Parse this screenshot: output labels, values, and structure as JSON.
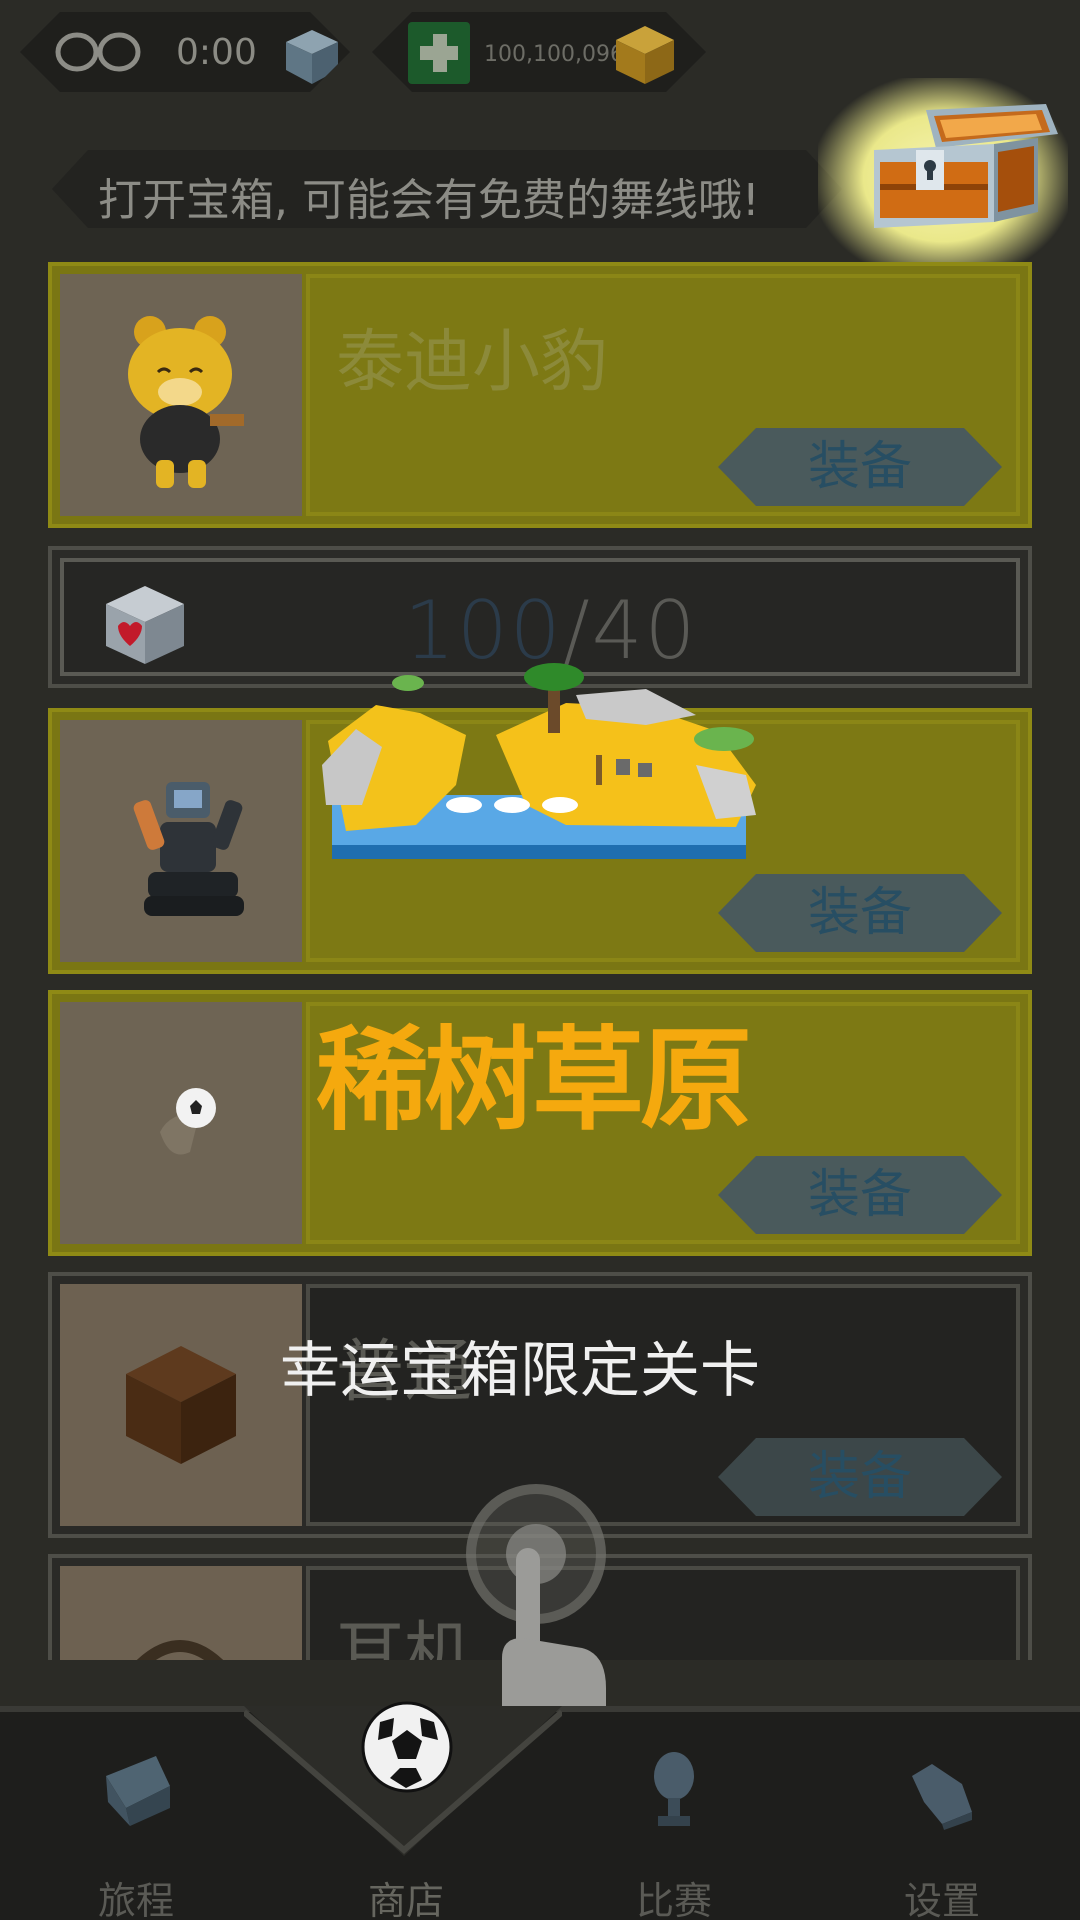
{
  "status_bar": {
    "lives_icon": "infinity-icon",
    "timer": "0:00",
    "cube_icon": "blue-cube-icon",
    "add_icon": "plus-icon",
    "coins": "100,100,096",
    "currency_icon": "gold-cube-icon"
  },
  "hint": {
    "text": "打开宝箱, 可能会有免费的舞线哦!",
    "chest_icon": "treasure-chest-icon"
  },
  "items": [
    {
      "name": "泰迪小豹",
      "button": "装备",
      "thumb_icon": "teddy-leopard-icon",
      "owned": true
    },
    {
      "name": "",
      "button": "装备",
      "thumb_icon": "robot-icon",
      "owned": true
    },
    {
      "name": "",
      "button": "装备",
      "thumb_icon": "soccer-ball-icon",
      "owned": true
    },
    {
      "name": "普通",
      "button": "装备",
      "thumb_icon": "brown-cube-icon",
      "owned": false
    },
    {
      "name": "耳机",
      "button": "",
      "thumb_icon": "headphones-icon",
      "owned": false
    }
  ],
  "counter": {
    "current": "100",
    "separator": "/",
    "max": "40",
    "icon": "heart-cube-icon"
  },
  "overlay": {
    "title": "稀树草原",
    "subtitle": "幸运宝箱限定关卡",
    "island_icon": "savanna-island-icon",
    "tap_icon": "tap-finger-icon"
  },
  "nav": {
    "items": [
      {
        "label": "旅程",
        "icon": "journey-icon"
      },
      {
        "label": "商店",
        "icon": "soccer-ball-icon"
      },
      {
        "label": "比赛",
        "icon": "trophy-icon"
      },
      {
        "label": "设置",
        "icon": "whistle-icon"
      }
    ],
    "active_index": 1
  },
  "colors": {
    "accent_title": "#f5a90e",
    "owned_card": "#7a7613",
    "button_text": "#274e63"
  }
}
